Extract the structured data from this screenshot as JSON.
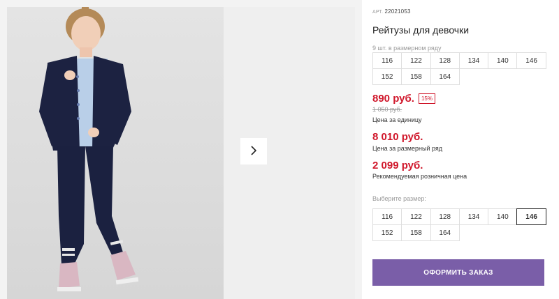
{
  "product": {
    "article_label": "АРТ.",
    "article_number": "22021053",
    "title": "Рейтузы для девочки"
  },
  "size_row": {
    "count_hint": "9 шт. в размерном ряду",
    "sizes": [
      "116",
      "122",
      "128",
      "134",
      "140",
      "146",
      "152",
      "158",
      "164"
    ]
  },
  "pricing": {
    "unit_price": "890 руб.",
    "discount": "15%",
    "old_price": "1 050 руб.",
    "unit_caption": "Цена за единицу",
    "row_price": "8 010 руб.",
    "row_caption": "Цена за размерный ряд",
    "retail_price": "2 099 руб.",
    "retail_caption": "Рекомендуемая розничная цена"
  },
  "size_select": {
    "hint": "Выберите размер:",
    "sizes": [
      "116",
      "122",
      "128",
      "134",
      "140",
      "146",
      "152",
      "158",
      "164"
    ],
    "selected": "146"
  },
  "actions": {
    "order_label": "ОФОРМИТЬ ЗАКАЗ",
    "next_icon": "chevron-right-icon"
  },
  "colors": {
    "price_red": "#d0172b",
    "button_purple": "#7a5ea8"
  }
}
